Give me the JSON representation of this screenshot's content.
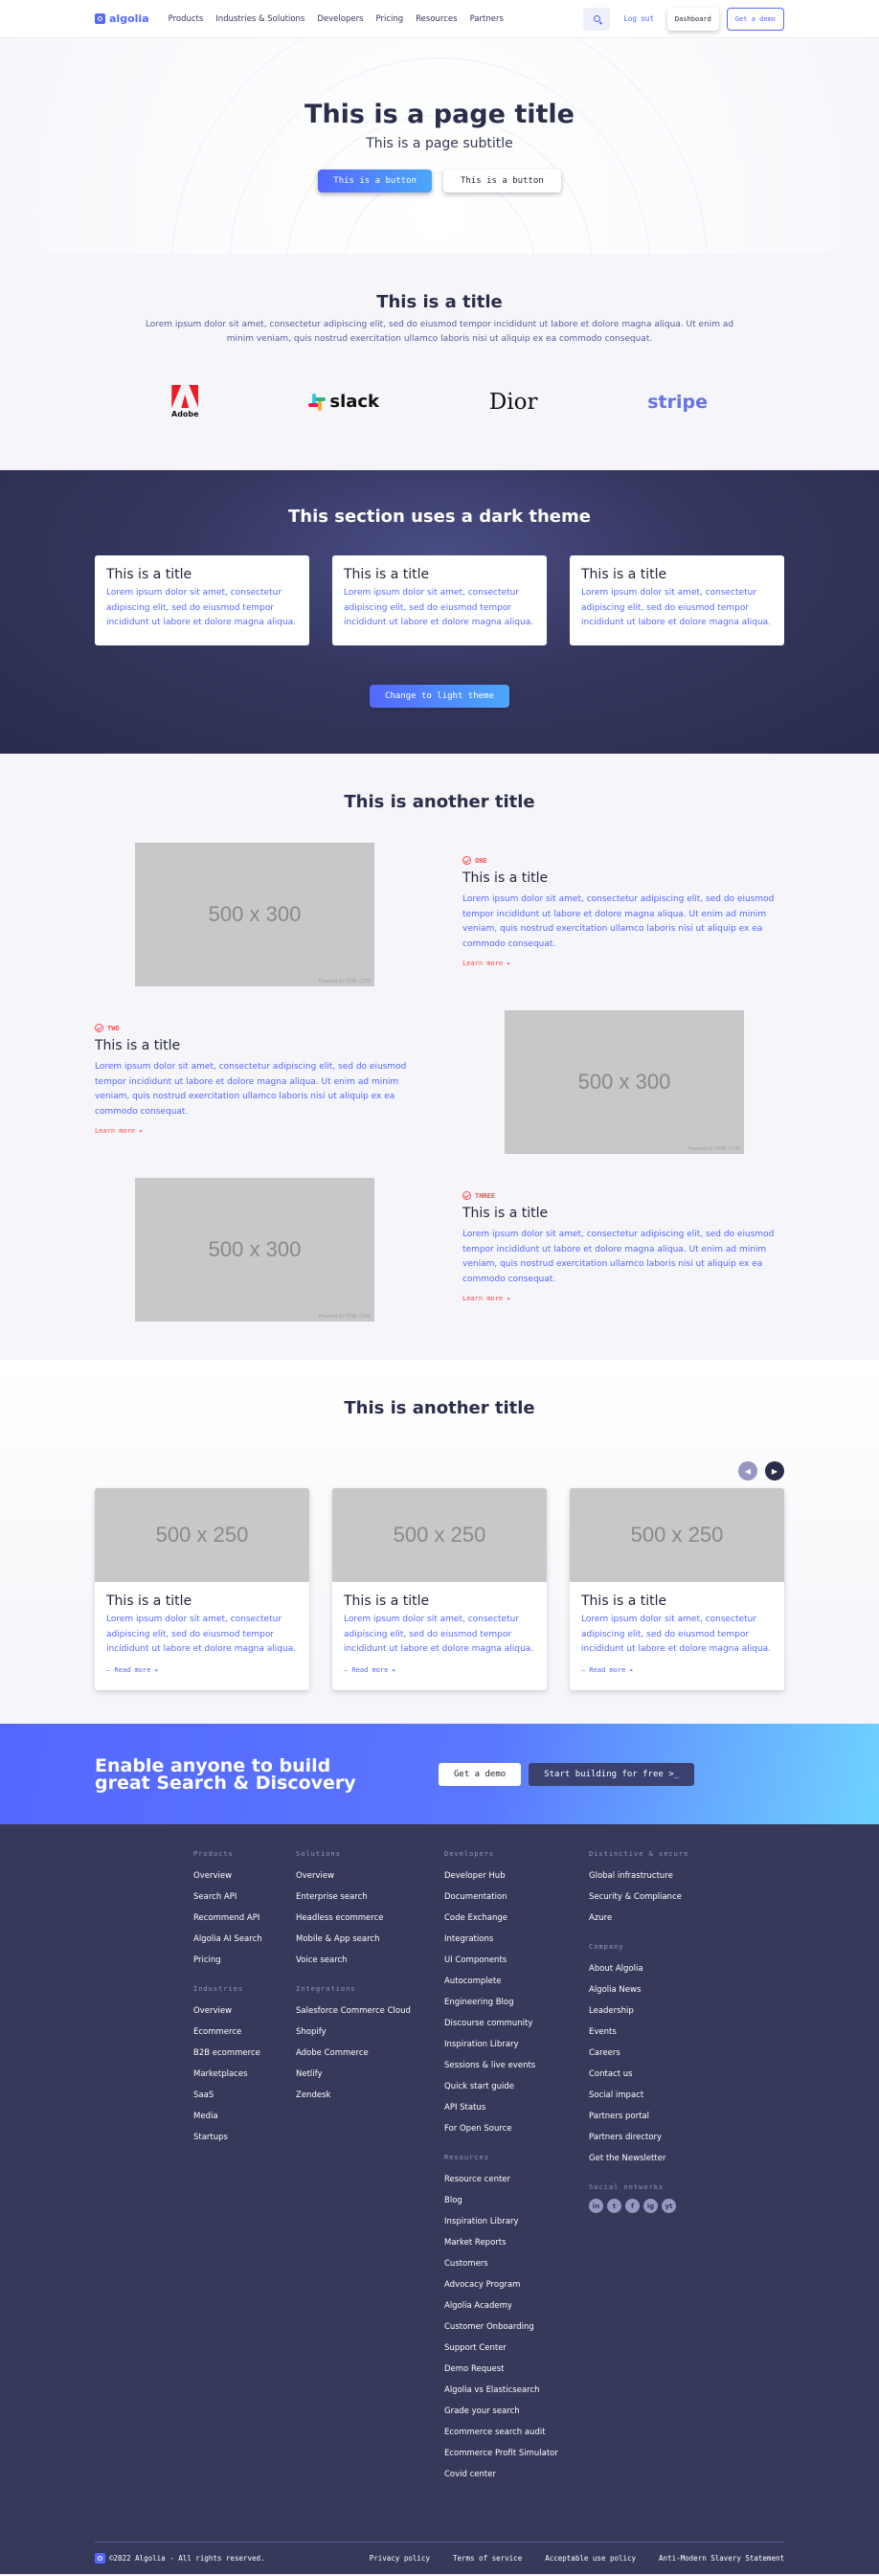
{
  "header": {
    "logo": "algolia",
    "nav": [
      "Products",
      "Industries & Solutions",
      "Developers",
      "Pricing",
      "Resources",
      "Partners"
    ],
    "login": "Log out",
    "dashboard": "Dashboard",
    "demo": "Get a demo"
  },
  "hero": {
    "title": "This is a page title",
    "subtitle": "This is a page subtitle",
    "primary_button": "This is a button",
    "secondary_button": "This is a button"
  },
  "logos": {
    "title": "This is a title",
    "text": "Lorem ipsum dolor sit amet, consectetur adipiscing elit, sed do eiusmod tempor incididunt ut labore et dolore magna aliqua. Ut enim ad minim veniam, quis nostrud exercitation ullamco laboris nisi ut aliquip ex ea commodo consequat.",
    "adobe": "Adobe",
    "slack": "slack",
    "dior": "Dior",
    "stripe": "stripe"
  },
  "dark": {
    "title": "This section uses a dark theme",
    "cards": [
      {
        "title": "This is a title",
        "text": "Lorem ipsum dolor sit amet, consectetur adipiscing elit, sed do eiusmod tempor incididunt ut labore et dolore magna aliqua."
      },
      {
        "title": "This is a title",
        "text": "Lorem ipsum dolor sit amet, consectetur adipiscing elit, sed do eiusmod tempor incididunt ut labore et dolore magna aliqua."
      },
      {
        "title": "This is a title",
        "text": "Lorem ipsum dolor sit amet, consectetur adipiscing elit, sed do eiusmod tempor incididunt ut labore et dolore magna aliqua."
      }
    ],
    "button": "Change to light theme"
  },
  "features": {
    "title": "This is another title",
    "items": [
      {
        "badge": "ONE",
        "title": "This is a title",
        "text": "Lorem ipsum dolor sit amet, consectetur adipiscing elit, sed do eiusmod tempor incididunt ut labore et dolore magna aliqua. Ut enim ad minim veniam, quis nostrud exercitation ullamco laboris nisi ut aliquip ex ea commodo consequat.",
        "more": "Learn more ▸",
        "image": "500 x 300",
        "powered": "Powered by HTML.COM"
      },
      {
        "badge": "TWO",
        "title": "This is a title",
        "text": "Lorem ipsum dolor sit amet, consectetur adipiscing elit, sed do eiusmod tempor incididunt ut labore et dolore magna aliqua. Ut enim ad minim veniam, quis nostrud exercitation ullamco laboris nisi ut aliquip ex ea commodo consequat.",
        "more": "Learn more ▸",
        "image": "500 x 300",
        "powered": "Powered by HTML.COM"
      },
      {
        "badge": "THREE",
        "title": "This is a title",
        "text": "Lorem ipsum dolor sit amet, consectetur adipiscing elit, sed do eiusmod tempor incididunt ut labore et dolore magna aliqua. Ut enim ad minim veniam, quis nostrud exercitation ullamco laboris nisi ut aliquip ex ea commodo consequat.",
        "more": "Learn more ▸",
        "image": "500 x 300",
        "powered": "Powered by HTML.COM"
      }
    ]
  },
  "carousel": {
    "title": "This is another title",
    "cards": [
      {
        "image": "500 x 250",
        "title": "This is a title",
        "text": "Lorem ipsum dolor sit amet, consectetur adipiscing elit, sed do eiusmod tempor incididunt ut labore et dolore magna aliqua.",
        "more": "— Read more ▸"
      },
      {
        "image": "500 x 250",
        "title": "This is a title",
        "text": "Lorem ipsum dolor sit amet, consectetur adipiscing elit, sed do eiusmod tempor incididunt ut labore et dolore magna aliqua.",
        "more": "— Read more ▸"
      },
      {
        "image": "500 x 250",
        "title": "This is a title",
        "text": "Lorem ipsum dolor sit amet, consectetur adipiscing elit, sed do eiusmod tempor incididunt ut labore et dolore magna aliqua.",
        "more": "— Read more ▸"
      }
    ]
  },
  "cta": {
    "line1": "Enable anyone to build",
    "line2": "great Search & Discovery",
    "demo": "Get a demo",
    "start": "Start building for free >_"
  },
  "footer": {
    "products": {
      "title": "Products",
      "links": [
        "Overview",
        "Search API",
        "Recommend API",
        "Algolia AI Search",
        "Pricing"
      ]
    },
    "industries": {
      "title": "Industries",
      "links": [
        "Overview",
        "Ecommerce",
        "B2B ecommerce",
        "Marketplaces",
        "SaaS",
        "Media",
        "Startups"
      ]
    },
    "solutions": {
      "title": "Solutions",
      "links": [
        "Overview",
        "Enterprise search",
        "Headless ecommerce",
        "Mobile & App search",
        "Voice search"
      ]
    },
    "integrations": {
      "title": "Integrations",
      "links": [
        "Salesforce Commerce Cloud",
        "Shopify",
        "Adobe Commerce",
        "Netlify",
        "Zendesk"
      ]
    },
    "developers": {
      "title": "Developers",
      "links": [
        "Developer Hub",
        "Documentation",
        "Code Exchange",
        "Integrations",
        "UI Components",
        "Autocomplete",
        "Engineering Blog",
        "Discourse community",
        "Inspiration Library",
        "Sessions & live events",
        "Quick start guide",
        "API Status",
        "For Open Source"
      ]
    },
    "resources": {
      "title": "Resources",
      "links": [
        "Resource center",
        "Blog",
        "Inspiration Library",
        "Market Reports",
        "Customers",
        "Advocacy Program",
        "Algolia Academy",
        "Customer Onboarding",
        "Support Center",
        "Demo Request",
        "Algolia vs Elasticsearch",
        "Grade your search",
        "Ecommerce search audit",
        "Ecommerce Profit Simulator",
        "Covid center"
      ]
    },
    "distinctive": {
      "title": "Distinctive & secure",
      "links": [
        "Global infrastructure",
        "Security & Compliance",
        "Azure"
      ]
    },
    "company": {
      "title": "Company",
      "links": [
        "About Algolia",
        "Algolia News",
        "Leadership",
        "Events",
        "Careers",
        "Contact us",
        "Social impact",
        "Partners portal",
        "Partners directory",
        "Get the Newsletter"
      ]
    },
    "social": {
      "title": "Social networks",
      "icons": [
        "in",
        "t",
        "f",
        "ig",
        "yt"
      ]
    },
    "copyright": "©2022 Algolia - All rights reserved.",
    "bottom_links": [
      "Privacy policy",
      "Terms of service",
      "Acceptable use policy",
      "Anti-Modern Slavery Statement"
    ]
  }
}
